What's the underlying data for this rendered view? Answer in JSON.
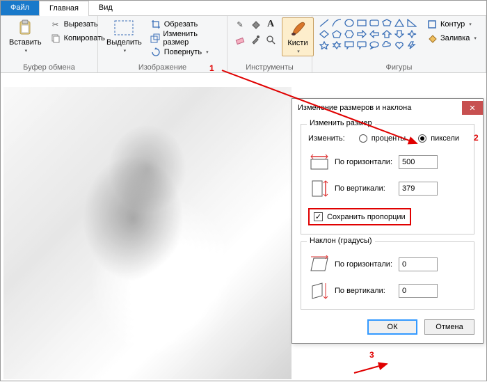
{
  "tabs": {
    "file": "Файл",
    "home": "Главная",
    "view": "Вид"
  },
  "clipboard": {
    "paste": "Вставить",
    "cut": "Вырезать",
    "copy": "Копировать",
    "group": "Буфер обмена"
  },
  "image": {
    "select": "Выделить",
    "crop": "Обрезать",
    "resize": "Изменить размер",
    "rotate": "Повернуть",
    "group": "Изображение"
  },
  "tools": {
    "group": "Инструменты",
    "brushes": "Кисти"
  },
  "shapes": {
    "group": "Фигуры",
    "outline": "Контур",
    "fill": "Заливка"
  },
  "dialog": {
    "title": "Изменение размеров и наклона",
    "resize_legend": "Изменить размер",
    "by_label": "Изменить:",
    "percent": "проценты",
    "pixels": "пиксели",
    "horizontal": "По горизонтали:",
    "vertical": "По вертикали:",
    "h_value": "500",
    "v_value": "379",
    "keep_ratio": "Сохранить пропорции",
    "skew_legend": "Наклон (градусы)",
    "skew_h": "0",
    "skew_v": "0",
    "ok": "ОК",
    "cancel": "Отмена"
  },
  "markers": {
    "m1": "1",
    "m2": "2",
    "m3": "3"
  }
}
